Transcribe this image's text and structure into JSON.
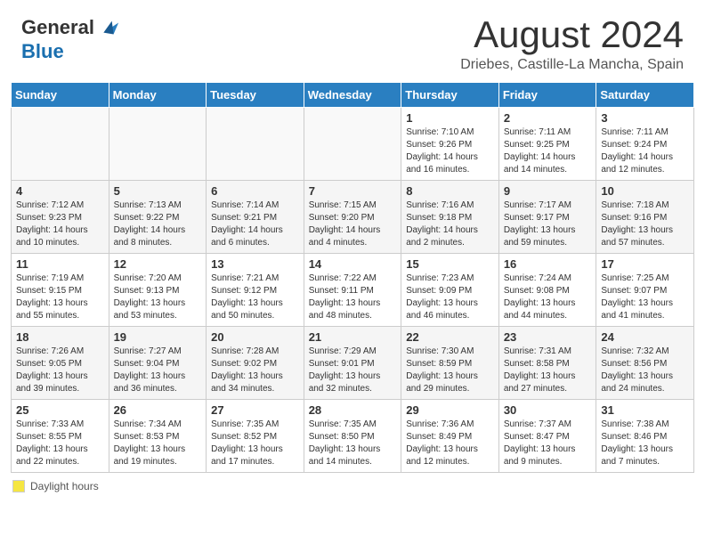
{
  "header": {
    "logo_general": "General",
    "logo_blue": "Blue",
    "month_year": "August 2024",
    "location": "Driebes, Castille-La Mancha, Spain"
  },
  "calendar": {
    "days_of_week": [
      "Sunday",
      "Monday",
      "Tuesday",
      "Wednesday",
      "Thursday",
      "Friday",
      "Saturday"
    ],
    "weeks": [
      [
        {
          "day": "",
          "info": ""
        },
        {
          "day": "",
          "info": ""
        },
        {
          "day": "",
          "info": ""
        },
        {
          "day": "",
          "info": ""
        },
        {
          "day": "1",
          "info": "Sunrise: 7:10 AM\nSunset: 9:26 PM\nDaylight: 14 hours and 16 minutes."
        },
        {
          "day": "2",
          "info": "Sunrise: 7:11 AM\nSunset: 9:25 PM\nDaylight: 14 hours and 14 minutes."
        },
        {
          "day": "3",
          "info": "Sunrise: 7:11 AM\nSunset: 9:24 PM\nDaylight: 14 hours and 12 minutes."
        }
      ],
      [
        {
          "day": "4",
          "info": "Sunrise: 7:12 AM\nSunset: 9:23 PM\nDaylight: 14 hours and 10 minutes."
        },
        {
          "day": "5",
          "info": "Sunrise: 7:13 AM\nSunset: 9:22 PM\nDaylight: 14 hours and 8 minutes."
        },
        {
          "day": "6",
          "info": "Sunrise: 7:14 AM\nSunset: 9:21 PM\nDaylight: 14 hours and 6 minutes."
        },
        {
          "day": "7",
          "info": "Sunrise: 7:15 AM\nSunset: 9:20 PM\nDaylight: 14 hours and 4 minutes."
        },
        {
          "day": "8",
          "info": "Sunrise: 7:16 AM\nSunset: 9:18 PM\nDaylight: 14 hours and 2 minutes."
        },
        {
          "day": "9",
          "info": "Sunrise: 7:17 AM\nSunset: 9:17 PM\nDaylight: 13 hours and 59 minutes."
        },
        {
          "day": "10",
          "info": "Sunrise: 7:18 AM\nSunset: 9:16 PM\nDaylight: 13 hours and 57 minutes."
        }
      ],
      [
        {
          "day": "11",
          "info": "Sunrise: 7:19 AM\nSunset: 9:15 PM\nDaylight: 13 hours and 55 minutes."
        },
        {
          "day": "12",
          "info": "Sunrise: 7:20 AM\nSunset: 9:13 PM\nDaylight: 13 hours and 53 minutes."
        },
        {
          "day": "13",
          "info": "Sunrise: 7:21 AM\nSunset: 9:12 PM\nDaylight: 13 hours and 50 minutes."
        },
        {
          "day": "14",
          "info": "Sunrise: 7:22 AM\nSunset: 9:11 PM\nDaylight: 13 hours and 48 minutes."
        },
        {
          "day": "15",
          "info": "Sunrise: 7:23 AM\nSunset: 9:09 PM\nDaylight: 13 hours and 46 minutes."
        },
        {
          "day": "16",
          "info": "Sunrise: 7:24 AM\nSunset: 9:08 PM\nDaylight: 13 hours and 44 minutes."
        },
        {
          "day": "17",
          "info": "Sunrise: 7:25 AM\nSunset: 9:07 PM\nDaylight: 13 hours and 41 minutes."
        }
      ],
      [
        {
          "day": "18",
          "info": "Sunrise: 7:26 AM\nSunset: 9:05 PM\nDaylight: 13 hours and 39 minutes."
        },
        {
          "day": "19",
          "info": "Sunrise: 7:27 AM\nSunset: 9:04 PM\nDaylight: 13 hours and 36 minutes."
        },
        {
          "day": "20",
          "info": "Sunrise: 7:28 AM\nSunset: 9:02 PM\nDaylight: 13 hours and 34 minutes."
        },
        {
          "day": "21",
          "info": "Sunrise: 7:29 AM\nSunset: 9:01 PM\nDaylight: 13 hours and 32 minutes."
        },
        {
          "day": "22",
          "info": "Sunrise: 7:30 AM\nSunset: 8:59 PM\nDaylight: 13 hours and 29 minutes."
        },
        {
          "day": "23",
          "info": "Sunrise: 7:31 AM\nSunset: 8:58 PM\nDaylight: 13 hours and 27 minutes."
        },
        {
          "day": "24",
          "info": "Sunrise: 7:32 AM\nSunset: 8:56 PM\nDaylight: 13 hours and 24 minutes."
        }
      ],
      [
        {
          "day": "25",
          "info": "Sunrise: 7:33 AM\nSunset: 8:55 PM\nDaylight: 13 hours and 22 minutes."
        },
        {
          "day": "26",
          "info": "Sunrise: 7:34 AM\nSunset: 8:53 PM\nDaylight: 13 hours and 19 minutes."
        },
        {
          "day": "27",
          "info": "Sunrise: 7:35 AM\nSunset: 8:52 PM\nDaylight: 13 hours and 17 minutes."
        },
        {
          "day": "28",
          "info": "Sunrise: 7:35 AM\nSunset: 8:50 PM\nDaylight: 13 hours and 14 minutes."
        },
        {
          "day": "29",
          "info": "Sunrise: 7:36 AM\nSunset: 8:49 PM\nDaylight: 13 hours and 12 minutes."
        },
        {
          "day": "30",
          "info": "Sunrise: 7:37 AM\nSunset: 8:47 PM\nDaylight: 13 hours and 9 minutes."
        },
        {
          "day": "31",
          "info": "Sunrise: 7:38 AM\nSunset: 8:46 PM\nDaylight: 13 hours and 7 minutes."
        }
      ]
    ]
  },
  "footer": {
    "daylight_label": "Daylight hours"
  }
}
